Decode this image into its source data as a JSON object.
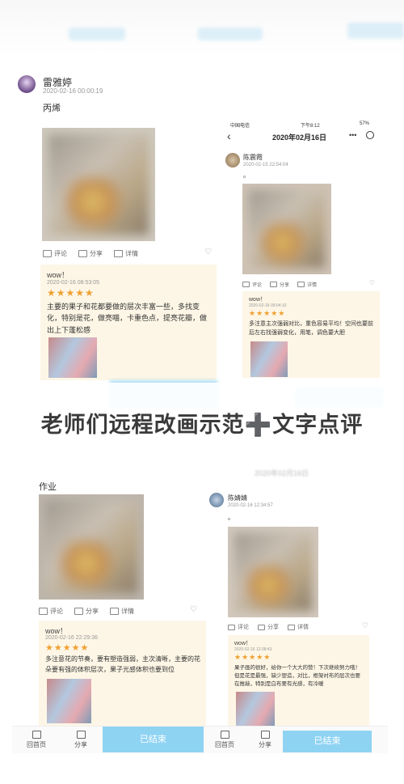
{
  "top_left_post": {
    "user": "雷雅婷",
    "date": "2020-02-16 00:00:19",
    "text": "丙烯",
    "actions": [
      "评论",
      "分享",
      "详情"
    ],
    "comment": {
      "title": "wow！",
      "date": "2020-02-16 08:53:05",
      "stars": "★★★★★",
      "text": "主要的果子和花都要做的层次丰富一些，多找变化，特别是花，做亮喵，卡重色点，提亮花瓣，做出上下蓬松感"
    }
  },
  "top_right_post": {
    "status": {
      "carrier": "中国电信",
      "time": "下午8:12",
      "battery": "57%"
    },
    "nav_title": "2020年02月16日",
    "user": "陈震霞",
    "date": "2020-02-15 22:54:04",
    "text": "。",
    "actions": [
      "评论",
      "分享",
      "详情"
    ],
    "comment": {
      "title": "wow！",
      "date": "2020-02-16 09:04:10",
      "stars": "★★★★★",
      "text": "多注意主次强弱对比，重色容易平均！空间也要前后左右找强弱变化，用笔，调色要大胆"
    }
  },
  "headline": "老师们远程改画示范➕文字点评",
  "bottom_left_post": {
    "text": "作业",
    "actions": [
      "评论",
      "分享",
      "详情"
    ],
    "comment": {
      "title": "wow！",
      "date": "2020-02-16 22:29:36",
      "stars": "★★★★★",
      "text": "多注意花的节奏，要有塑造强弱，主次清晰，主要的花朵要有强的体积层次，果子光感体积也要到位"
    },
    "tabbar": {
      "home": "回首页",
      "share": "分享",
      "status": "已结束"
    }
  },
  "bottom_right_post": {
    "nav_title": "2020年02月16日",
    "user": "陈婧婧",
    "date": "2020-02-16 12:34:57",
    "text": "。",
    "actions": [
      "评论",
      "分享",
      "详情"
    ],
    "comment": {
      "title": "wow！",
      "date": "2020-02-16 12:38:43",
      "stars": "★★★★★",
      "text": "果子画的很好，给你一个大大的赞！下次继续努力哦！但是花是最强，缺少塑造，对比，框架衬布的层次也要在推敲，特别是白布要有光感，有冷暖"
    },
    "tabbar": {
      "home": "回首页",
      "share": "分享",
      "status": "已结束"
    }
  }
}
